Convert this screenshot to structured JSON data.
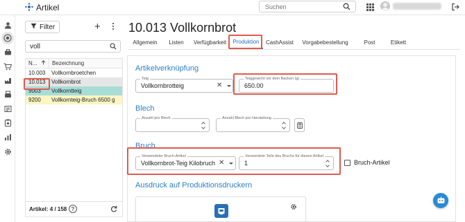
{
  "app": {
    "title": "Artikel",
    "search_placeholder": "Suchen",
    "accent_color": "#2a6fb5"
  },
  "rail": {
    "items": [
      "user-icon",
      "tenant-icon",
      "briefcase-icon",
      "cart-icon",
      "factory-icon",
      "register-icon",
      "list-icon",
      "clipboard-icon",
      "chart-icon",
      "gear-icon"
    ]
  },
  "list_panel": {
    "filter_label": "Filter",
    "search_value": "voll",
    "columns": [
      "N...",
      "Bezeichnung"
    ],
    "rows": [
      {
        "nr": "10.003",
        "name": "Vollkornbroetchen",
        "style": "normal"
      },
      {
        "nr": "10.013",
        "name": "Vollkornbrot",
        "style": "selected"
      },
      {
        "nr": "9003",
        "name": "Vollkorntteig",
        "style": "teal"
      },
      {
        "nr": "9200",
        "name": "Vollkornteig-Bruch 6500 g",
        "style": "yellow"
      }
    ],
    "footer": "Artikel: 4 / 158"
  },
  "main": {
    "title": "10.013 Vollkornbrot",
    "tabs": [
      {
        "label": "Allgemein",
        "active": false
      },
      {
        "label": "Listen",
        "active": false
      },
      {
        "label": "Verfügbarkeit",
        "active": false
      },
      {
        "label": "Produktion",
        "active": true
      },
      {
        "label": "CashAssist",
        "active": false
      },
      {
        "label": "Vorgabebestellung",
        "active": false
      },
      {
        "label": "Post",
        "active": false
      },
      {
        "label": "Etikett",
        "active": false
      }
    ]
  },
  "artikelverknuepfung": {
    "title": "Artikelverknüpfung",
    "teig_label": "Teig",
    "teig_value": "Vollkornbrotteig",
    "teiggewicht_label": "Teiggewicht vor dem Backen (g)",
    "teiggewicht_value": "650.00"
  },
  "blech": {
    "title": "Blech",
    "anzahl_pro_blech_label": "Anzahl pro Blech",
    "anzahl_pro_blech_value": "",
    "anzahl_blech_label": "Anzahl Blech pro Herstellung",
    "anzahl_blech_value": ""
  },
  "bruch": {
    "title": "Bruch",
    "artikel_label": "Verwendeter Bruch-Artikel",
    "artikel_value": "Vollkornbrot-Teig Kilobruch",
    "teile_label": "Verwendete Teile des Bruchs für diesen Artikel",
    "teile_value": "1",
    "checkbox_label": "Bruch-Artikel",
    "checkbox_checked": false
  },
  "druck": {
    "title": "Ausdruck auf Produktionsdruckern"
  },
  "colors": {
    "highlight": "#e05a4d",
    "teal_row": "#a8dcd7",
    "yellow_row": "#fbf5c2",
    "section_title": "#2a7fc9"
  }
}
